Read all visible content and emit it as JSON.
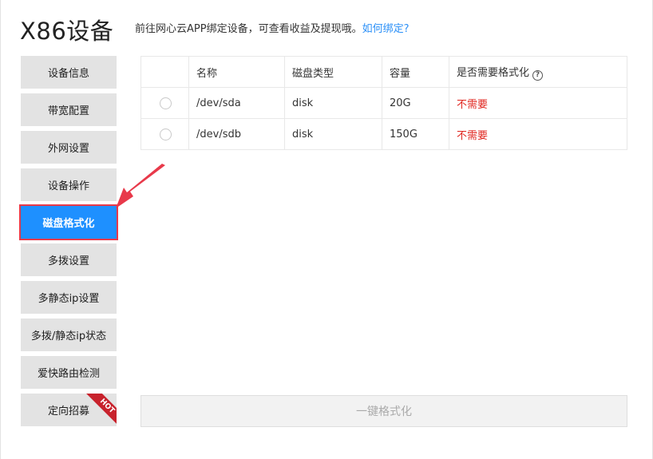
{
  "header": {
    "title": "X86设备",
    "subtitle": "前往网心云APP绑定设备，可查看收益及提现哦。",
    "help_link": "如何绑定?"
  },
  "sidebar": {
    "items": [
      {
        "label": "设备信息"
      },
      {
        "label": "带宽配置"
      },
      {
        "label": "外网设置"
      },
      {
        "label": "设备操作"
      },
      {
        "label": "磁盘格式化",
        "active": true
      },
      {
        "label": "多拨设置"
      },
      {
        "label": "多静态ip设置"
      },
      {
        "label": "多拨/静态ip状态"
      },
      {
        "label": "爱快路由检测"
      },
      {
        "label": "定向招募",
        "badge": "HOT"
      }
    ]
  },
  "table": {
    "headers": [
      "",
      "名称",
      "磁盘类型",
      "容量",
      "是否需要格式化"
    ],
    "rows": [
      {
        "name": "/dev/sda",
        "type": "disk",
        "capacity": "20G",
        "format": "不需要"
      },
      {
        "name": "/dev/sdb",
        "type": "disk",
        "capacity": "150G",
        "format": "不需要"
      }
    ]
  },
  "actions": {
    "format_button": "一键格式化"
  },
  "colors": {
    "active": "#1e90ff",
    "highlight": "#e8394a",
    "link": "#2a8ff7",
    "warning_text": "#e0261f"
  },
  "icons": {
    "help": "question-circle-icon",
    "pointer": "red-arrow-icon"
  }
}
